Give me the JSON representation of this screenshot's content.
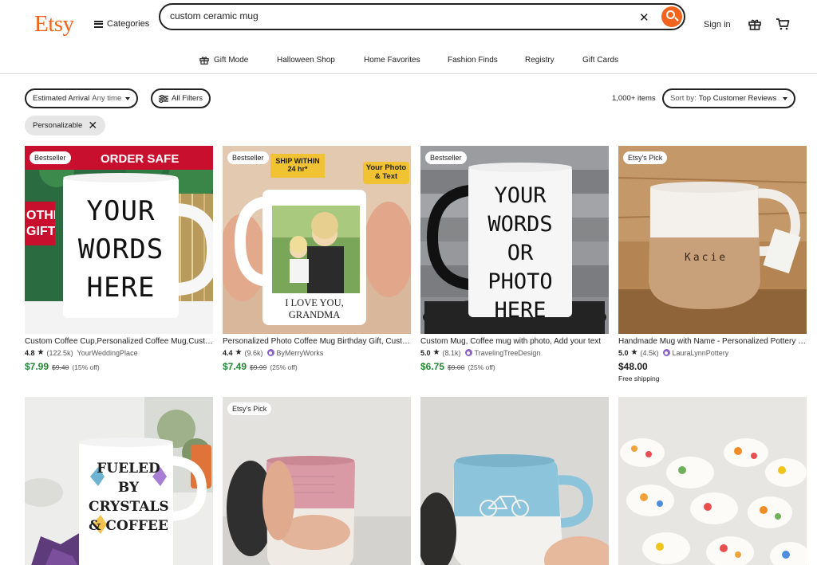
{
  "header": {
    "logo": "Etsy",
    "categories_label": "Categories",
    "search_value": "custom ceramic mug",
    "signin_label": "Sign in"
  },
  "nav": {
    "items": [
      "Gift Mode",
      "Halloween Shop",
      "Home Favorites",
      "Fashion Finds",
      "Registry",
      "Gift Cards"
    ]
  },
  "filters": {
    "arrival_label": "Estimated Arrival",
    "arrival_value": "Any time",
    "all_filters": "All Filters",
    "count": "1,000+ items",
    "sort_label": "Sort by:",
    "sort_value": "Top Customer Reviews",
    "chip": "Personalizable"
  },
  "products": [
    {
      "badge": "Bestseller",
      "title": "Custom Coffee Cup,Personalized Coffee Mug,Custom Text Mug",
      "rating": "4.8",
      "reviews": "(122.5k)",
      "seller": "YourWeddingPlace",
      "star_seller": false,
      "price": "$7.99",
      "original": "$9.40",
      "discount": "(15% off)",
      "shipping": ""
    },
    {
      "badge": "Bestseller",
      "title": "Personalized Photo Coffee Mug Birthday Gift, Custom Photo Mug",
      "rating": "4.4",
      "reviews": "(9.6k)",
      "seller": "ByMerryWorks",
      "star_seller": true,
      "price": "$7.49",
      "original": "$9.99",
      "discount": "(25% off)",
      "shipping": ""
    },
    {
      "badge": "Bestseller",
      "title": "Custom Mug, Coffee mug with photo, Add your text",
      "rating": "5.0",
      "reviews": "(8.1k)",
      "seller": "TravelingTreeDesign",
      "star_seller": true,
      "price": "$6.75",
      "original": "$9.00",
      "discount": "(25% off)",
      "shipping": ""
    },
    {
      "badge": "Etsy's Pick",
      "title": "Handmade Mug with Name - Personalized Pottery Mug",
      "rating": "5.0",
      "reviews": "(4.5k)",
      "seller": "LauraLynnPottery",
      "star_seller": true,
      "price": "$48.00",
      "original": "",
      "discount": "",
      "shipping": "Free shipping"
    },
    {
      "badge": "",
      "title": "",
      "rating": "",
      "reviews": "",
      "seller": "",
      "star_seller": false,
      "price": "",
      "original": "",
      "discount": "",
      "shipping": ""
    },
    {
      "badge": "Etsy's Pick",
      "title": "",
      "rating": "",
      "reviews": "",
      "seller": "",
      "star_seller": false,
      "price": "",
      "original": "",
      "discount": "",
      "shipping": ""
    },
    {
      "badge": "",
      "title": "",
      "rating": "",
      "reviews": "",
      "seller": "",
      "star_seller": false,
      "price": "",
      "original": "",
      "discount": "",
      "shipping": ""
    },
    {
      "badge": "",
      "title": "",
      "rating": "",
      "reviews": "",
      "seller": "",
      "star_seller": false,
      "price": "",
      "original": "",
      "discount": "",
      "shipping": ""
    }
  ],
  "image_text": {
    "p1_promo": "ORDER SAFE",
    "p1_side": "OTHER GIFTS!",
    "p1_mug": [
      "YOUR",
      "WORDS",
      "HERE"
    ],
    "p2_ship": "SHIP WITHIN 24 hr*",
    "p2_tag": [
      "Your Photo",
      "& Text"
    ],
    "p2_mug": "I LOVE YOU, GRANDMA",
    "p3_mug": [
      "YOUR",
      "WORDS",
      "OR PHOTO",
      "HERE"
    ],
    "p4_name": "Kacie",
    "p5_mug": [
      "FUELED",
      "BY",
      "CRYSTALS",
      "& COFFEE"
    ]
  },
  "colors": {
    "brand": "#F1641E",
    "sale_price": "#258635",
    "star_seller": "#8e63c9"
  },
  "icons": [
    "hamburger-icon",
    "search-icon",
    "clear-icon",
    "gift-icon",
    "cart-icon",
    "filters-icon",
    "star-icon",
    "star-seller-icon"
  ]
}
